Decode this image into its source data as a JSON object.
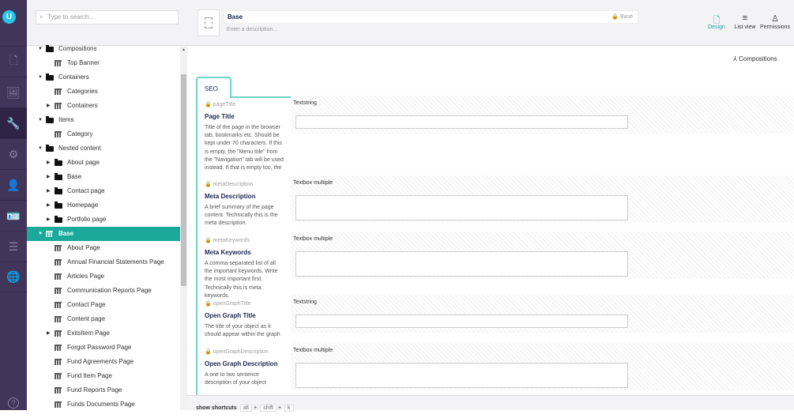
{
  "search": {
    "placeholder": "Type to search..."
  },
  "rail": {
    "logo": "U",
    "sections": [
      "content",
      "media",
      "settings",
      "developer",
      "users",
      "members",
      "forms",
      "translation"
    ],
    "help": "?"
  },
  "tree": [
    {
      "label": "Compositions",
      "level": 0,
      "type": "folder",
      "caret": "down"
    },
    {
      "label": "Top Banner",
      "level": 1,
      "type": "doctype",
      "caret": ""
    },
    {
      "label": "Containers",
      "level": 0,
      "type": "folder",
      "caret": "down"
    },
    {
      "label": "Categories",
      "level": 1,
      "type": "doctype",
      "caret": ""
    },
    {
      "label": "Containers",
      "level": 1,
      "type": "doctype",
      "caret": "right"
    },
    {
      "label": "Items",
      "level": 0,
      "type": "folder",
      "caret": "down"
    },
    {
      "label": "Category",
      "level": 1,
      "type": "doctype",
      "caret": ""
    },
    {
      "label": "Nested content",
      "level": 0,
      "type": "folder",
      "caret": "down"
    },
    {
      "label": "About page",
      "level": 1,
      "type": "folder",
      "caret": "right"
    },
    {
      "label": "Base",
      "level": 1,
      "type": "folder",
      "caret": "right"
    },
    {
      "label": "Contact page",
      "level": 1,
      "type": "folder",
      "caret": "right"
    },
    {
      "label": "Homepage",
      "level": 1,
      "type": "folder",
      "caret": "right"
    },
    {
      "label": "Portfolio page",
      "level": 1,
      "type": "folder",
      "caret": "right"
    },
    {
      "label": "Base",
      "level": 0,
      "type": "doctype",
      "caret": "down",
      "selected": true
    },
    {
      "label": "About Page",
      "level": 1,
      "type": "doctype",
      "caret": ""
    },
    {
      "label": "Annual Financial Statements Page",
      "level": 1,
      "type": "doctype",
      "caret": ""
    },
    {
      "label": "Articles Page",
      "level": 1,
      "type": "doctype",
      "caret": ""
    },
    {
      "label": "Communication Reports Page",
      "level": 1,
      "type": "doctype",
      "caret": ""
    },
    {
      "label": "Contact Page",
      "level": 1,
      "type": "doctype",
      "caret": ""
    },
    {
      "label": "Content page",
      "level": 1,
      "type": "doctype",
      "caret": ""
    },
    {
      "label": "ExitsItem Page",
      "level": 1,
      "type": "doctype",
      "caret": "right"
    },
    {
      "label": "Forgot Password Page",
      "level": 1,
      "type": "doctype",
      "caret": ""
    },
    {
      "label": "Fund Agreements Page",
      "level": 1,
      "type": "doctype",
      "caret": ""
    },
    {
      "label": "Fund Item Page",
      "level": 1,
      "type": "doctype",
      "caret": ""
    },
    {
      "label": "Fund Reports Page",
      "level": 1,
      "type": "doctype",
      "caret": ""
    },
    {
      "label": "Funds Documents Page",
      "level": 1,
      "type": "doctype",
      "caret": ""
    }
  ],
  "header": {
    "name": "Base",
    "alias": "Base",
    "description_placeholder": "Enter a description...",
    "buttons": [
      {
        "label": "Design",
        "icon": "document-icon",
        "active": true
      },
      {
        "label": "List view",
        "icon": "list-icon"
      },
      {
        "label": "Permissions",
        "icon": "permissions-icon"
      }
    ]
  },
  "compositions_label": "Compositions",
  "tab": "SEO",
  "properties": [
    {
      "alias": "pageTitle",
      "label": "Page Title",
      "description": "Title of the page in the browser tab, bookmarks etc. Should be kept under 70 characters. If this is empty, the \"Menu title\" from the \"Navigation\" tab will be used instead. If that is empty too, the",
      "editor": "Textstring"
    },
    {
      "alias": "metaDescription",
      "label": "Meta Description",
      "description": "A brief summary of the page content. Technically this is the meta description.",
      "editor": "Textbox multiple"
    },
    {
      "alias": "metaKeywords",
      "label": "Meta Keywords",
      "description": "A comma-separated list of all the important keywords. Write the most important first. Technically this is meta keywords.",
      "editor": "Textbox multiple"
    },
    {
      "alias": "openGraphTitle",
      "label": "Open Graph Title",
      "description": "The title of your object as it should appear within the graph",
      "editor": "Textstring"
    },
    {
      "alias": "openGraphDescription",
      "label": "Open Graph Description",
      "description": "A one to two sentence description of your object",
      "editor": "Textbox multiple"
    }
  ],
  "footer": {
    "label": "show shortcuts",
    "keys": [
      "alt",
      "shift",
      "k"
    ],
    "plus": "+"
  }
}
